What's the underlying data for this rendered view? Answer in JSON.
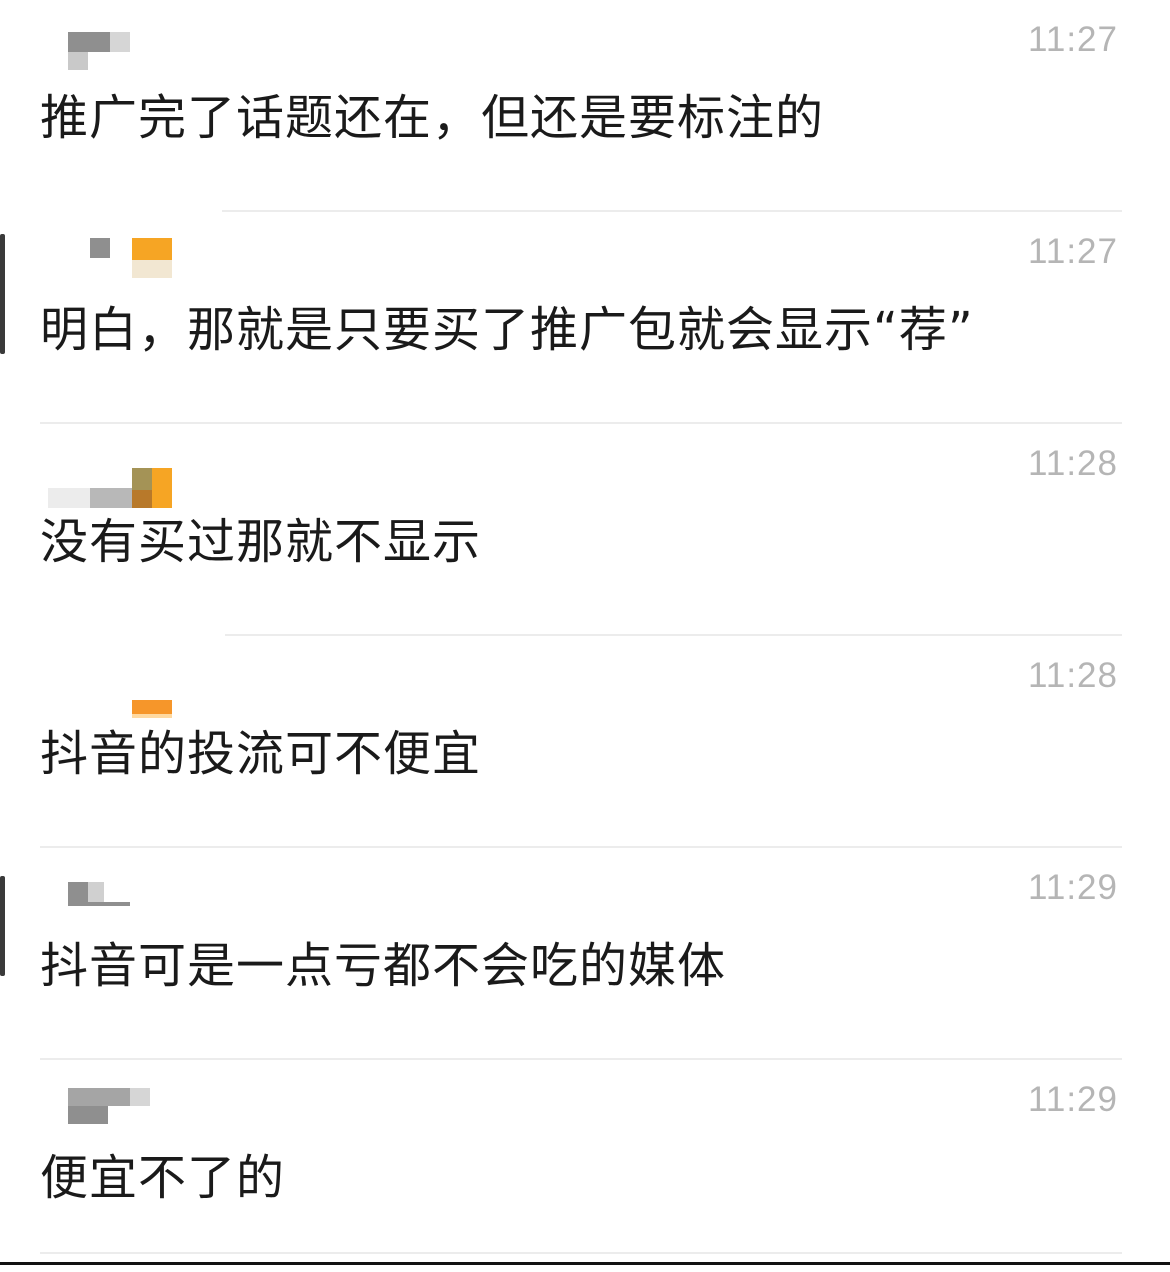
{
  "messages": [
    {
      "time": "11:27",
      "text": "推广完了话题还在，但还是要标注的"
    },
    {
      "time": "11:27",
      "text": "明白，那就是只要买了推广包就会显示“荐”"
    },
    {
      "time": "11:28",
      "text": "没有买过那就不显示"
    },
    {
      "time": "11:28",
      "text": "抖音的投流可不便宜"
    },
    {
      "time": "11:29",
      "text": "抖音可是一点亏都不会吃的媒体"
    },
    {
      "time": "11:29",
      "text": "便宜不了的"
    }
  ],
  "colors": {
    "text": "#1a1a1a",
    "timestamp": "#b5b5b5",
    "divider": "#ececec",
    "avatar_blur_orange": "#f6a524"
  }
}
